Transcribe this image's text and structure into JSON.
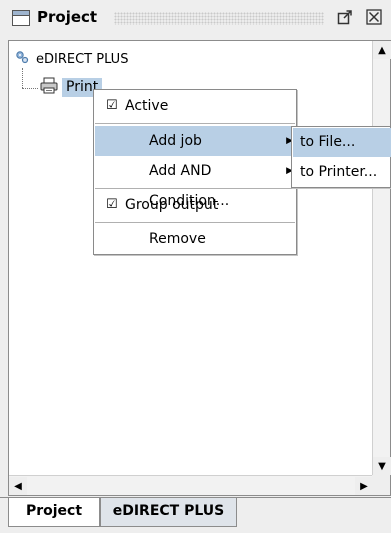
{
  "window": {
    "title": "Project"
  },
  "tree": {
    "root": {
      "label": "eDIRECT PLUS",
      "icon": "gears-icon"
    },
    "child": {
      "label": "Print",
      "icon": "printer-icon"
    }
  },
  "context_menu": {
    "active_label": "Active",
    "active_checked": true,
    "add_job_label": "Add job",
    "add_condition_label": "Add AND Condition...",
    "group_output_label": "Group output",
    "group_output_checked": true,
    "remove_label": "Remove"
  },
  "submenu": {
    "to_file_label": "to File...",
    "to_printer_label": "to Printer..."
  },
  "tabs": [
    {
      "label": "Project",
      "selected": true
    },
    {
      "label": "eDIRECT PLUS",
      "selected": false
    }
  ],
  "colors": {
    "selection": "#b8cfe5",
    "panel_bg": "#eeeeee",
    "border": "#8c8c8c"
  }
}
